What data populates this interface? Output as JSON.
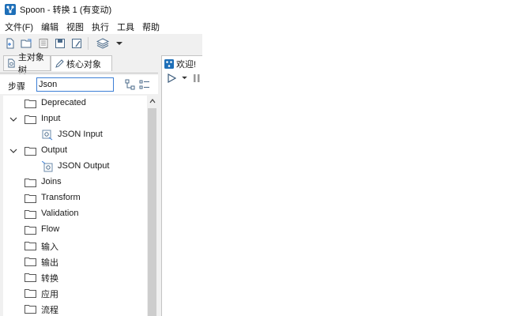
{
  "window": {
    "title": "Spoon - 转换 1 (有变动)"
  },
  "menu": [
    "文件(F)",
    "编辑",
    "视图",
    "执行",
    "工具",
    "帮助"
  ],
  "toolbar": {
    "icons": [
      "new-file-icon",
      "open-folder-icon",
      "explore-repository-icon",
      "save-icon",
      "save-as-icon",
      "layers-perspective-icon",
      "dropdown-arrow-icon"
    ]
  },
  "left_tabs": [
    {
      "label": "主对象树",
      "icon": "document-icon"
    },
    {
      "label": "核心对象",
      "icon": "pencil-icon"
    }
  ],
  "search": {
    "label": "步骤",
    "value": "Json"
  },
  "tree": [
    {
      "label": "Deprecated",
      "type": "folder",
      "expanded": false
    },
    {
      "label": "Input",
      "type": "folder",
      "expanded": true
    },
    {
      "label": "JSON Input",
      "type": "step"
    },
    {
      "label": "Output",
      "type": "folder",
      "expanded": true
    },
    {
      "label": "JSON Output",
      "type": "step"
    },
    {
      "label": "Joins",
      "type": "folder",
      "expanded": false
    },
    {
      "label": "Transform",
      "type": "folder",
      "expanded": false
    },
    {
      "label": "Validation",
      "type": "folder",
      "expanded": false
    },
    {
      "label": "Flow",
      "type": "folder",
      "expanded": false
    },
    {
      "label": "输入",
      "type": "folder",
      "expanded": false
    },
    {
      "label": "输出",
      "type": "folder",
      "expanded": false
    },
    {
      "label": "转换",
      "type": "folder",
      "expanded": false
    },
    {
      "label": "应用",
      "type": "folder",
      "expanded": false
    },
    {
      "label": "流程",
      "type": "folder",
      "expanded": false
    }
  ],
  "right_tab": {
    "label": "欢迎!"
  },
  "colors": {
    "accent": "#3c7fd6",
    "logo": "#1e6fb8"
  }
}
